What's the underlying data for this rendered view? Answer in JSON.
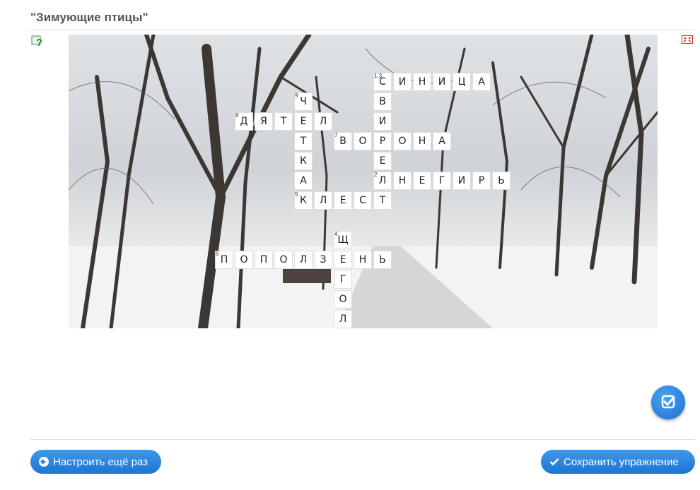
{
  "exercise": {
    "title": "\"Зимующие птицы\""
  },
  "icons": {
    "help": "help-question-icon",
    "fullscreen": "fullscreen-icon",
    "check": "check-square-icon",
    "back": "arrow-left-icon",
    "save": "checkmark-icon"
  },
  "crossword": {
    "letters": [
      "С",
      "И",
      "Н",
      "И",
      "Ц",
      "А",
      "В",
      "И",
      "Р",
      "Е",
      "Л",
      "Ч",
      "Е",
      "Т",
      "К",
      "А",
      "Д",
      "Я",
      "Т",
      "Е",
      "Л",
      "В",
      "О",
      "Р",
      "О",
      "Н",
      "А",
      "С",
      "Н",
      "Е",
      "Г",
      "И",
      "Р",
      "Ь",
      "К",
      "Л",
      "Е",
      "С",
      "Т",
      "Щ",
      "Е",
      "Г",
      "О",
      "Л",
      "П",
      "О",
      "П",
      "О",
      "Л",
      "З",
      "Е",
      "Н",
      "Ь"
    ],
    "numbers": [
      "1,3",
      "9",
      "8",
      "7",
      "2",
      "5",
      "4",
      "6"
    ]
  },
  "buttons": {
    "reset": "Настроить ещё раз",
    "save": "Сохранить упражнение"
  },
  "colors": {
    "button": "#2a86de",
    "title": "#555555"
  }
}
